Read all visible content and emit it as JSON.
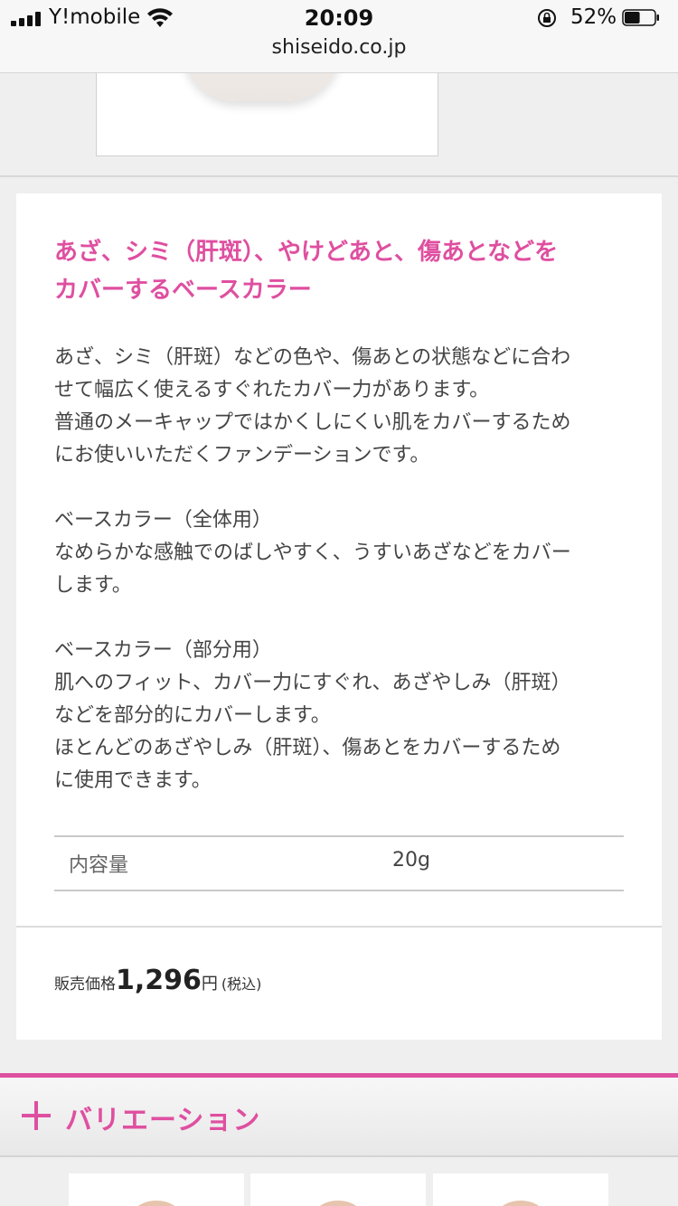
{
  "status_bar": {
    "carrier": "Y!mobile",
    "time": "20:09",
    "battery": "52%",
    "battery_level": 0.52
  },
  "browser": {
    "url": "shiseido.co.jp"
  },
  "product": {
    "headline_lines": [
      "あざ、シミ（肝斑）、やけどあと、傷あとなどを",
      "カバーするベースカラー"
    ],
    "paragraphs": [
      [
        "あざ、シミ（肝斑）などの色や、傷あとの状態などに合わ",
        "せて幅広く使えるすぐれたカバー力があります。",
        "普通のメーキャップではかくしにくい肌をカバーするため",
        "にお使いいただくファンデーションです。"
      ],
      [
        "ベースカラー（全体用）",
        "なめらかな感触でのばしやすく、うすいあざなどをカバー",
        "します。"
      ],
      [
        "ベースカラー（部分用）",
        "肌へのフィット、カバー力にすぐれ、あざやしみ（肝斑）",
        "などを部分的にカバーします。",
        "ほとんどのあざやしみ（肝斑）、傷あとをカバーするため",
        "に使用できます。"
      ]
    ],
    "spec": {
      "label": "内容量",
      "value": "20g"
    },
    "price": {
      "label": "販売価格",
      "amount": "1,296",
      "currency": "円",
      "tax_note": "(税込)"
    }
  },
  "variation": {
    "title": "バリエーション"
  },
  "colors": {
    "accent": "#df4fa0"
  }
}
